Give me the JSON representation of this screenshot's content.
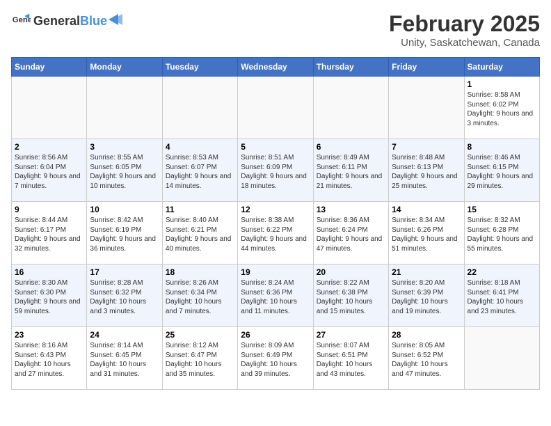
{
  "header": {
    "logo_general": "General",
    "logo_blue": "Blue",
    "title": "February 2025",
    "subtitle": "Unity, Saskatchewan, Canada"
  },
  "weekdays": [
    "Sunday",
    "Monday",
    "Tuesday",
    "Wednesday",
    "Thursday",
    "Friday",
    "Saturday"
  ],
  "weeks": [
    [
      {
        "day": "",
        "info": ""
      },
      {
        "day": "",
        "info": ""
      },
      {
        "day": "",
        "info": ""
      },
      {
        "day": "",
        "info": ""
      },
      {
        "day": "",
        "info": ""
      },
      {
        "day": "",
        "info": ""
      },
      {
        "day": "1",
        "info": "Sunrise: 8:58 AM\nSunset: 6:02 PM\nDaylight: 9 hours and 3 minutes."
      }
    ],
    [
      {
        "day": "2",
        "info": "Sunrise: 8:56 AM\nSunset: 6:04 PM\nDaylight: 9 hours and 7 minutes."
      },
      {
        "day": "3",
        "info": "Sunrise: 8:55 AM\nSunset: 6:05 PM\nDaylight: 9 hours and 10 minutes."
      },
      {
        "day": "4",
        "info": "Sunrise: 8:53 AM\nSunset: 6:07 PM\nDaylight: 9 hours and 14 minutes."
      },
      {
        "day": "5",
        "info": "Sunrise: 8:51 AM\nSunset: 6:09 PM\nDaylight: 9 hours and 18 minutes."
      },
      {
        "day": "6",
        "info": "Sunrise: 8:49 AM\nSunset: 6:11 PM\nDaylight: 9 hours and 21 minutes."
      },
      {
        "day": "7",
        "info": "Sunrise: 8:48 AM\nSunset: 6:13 PM\nDaylight: 9 hours and 25 minutes."
      },
      {
        "day": "8",
        "info": "Sunrise: 8:46 AM\nSunset: 6:15 PM\nDaylight: 9 hours and 29 minutes."
      }
    ],
    [
      {
        "day": "9",
        "info": "Sunrise: 8:44 AM\nSunset: 6:17 PM\nDaylight: 9 hours and 32 minutes."
      },
      {
        "day": "10",
        "info": "Sunrise: 8:42 AM\nSunset: 6:19 PM\nDaylight: 9 hours and 36 minutes."
      },
      {
        "day": "11",
        "info": "Sunrise: 8:40 AM\nSunset: 6:21 PM\nDaylight: 9 hours and 40 minutes."
      },
      {
        "day": "12",
        "info": "Sunrise: 8:38 AM\nSunset: 6:22 PM\nDaylight: 9 hours and 44 minutes."
      },
      {
        "day": "13",
        "info": "Sunrise: 8:36 AM\nSunset: 6:24 PM\nDaylight: 9 hours and 47 minutes."
      },
      {
        "day": "14",
        "info": "Sunrise: 8:34 AM\nSunset: 6:26 PM\nDaylight: 9 hours and 51 minutes."
      },
      {
        "day": "15",
        "info": "Sunrise: 8:32 AM\nSunset: 6:28 PM\nDaylight: 9 hours and 55 minutes."
      }
    ],
    [
      {
        "day": "16",
        "info": "Sunrise: 8:30 AM\nSunset: 6:30 PM\nDaylight: 9 hours and 59 minutes."
      },
      {
        "day": "17",
        "info": "Sunrise: 8:28 AM\nSunset: 6:32 PM\nDaylight: 10 hours and 3 minutes."
      },
      {
        "day": "18",
        "info": "Sunrise: 8:26 AM\nSunset: 6:34 PM\nDaylight: 10 hours and 7 minutes."
      },
      {
        "day": "19",
        "info": "Sunrise: 8:24 AM\nSunset: 6:36 PM\nDaylight: 10 hours and 11 minutes."
      },
      {
        "day": "20",
        "info": "Sunrise: 8:22 AM\nSunset: 6:38 PM\nDaylight: 10 hours and 15 minutes."
      },
      {
        "day": "21",
        "info": "Sunrise: 8:20 AM\nSunset: 6:39 PM\nDaylight: 10 hours and 19 minutes."
      },
      {
        "day": "22",
        "info": "Sunrise: 8:18 AM\nSunset: 6:41 PM\nDaylight: 10 hours and 23 minutes."
      }
    ],
    [
      {
        "day": "23",
        "info": "Sunrise: 8:16 AM\nSunset: 6:43 PM\nDaylight: 10 hours and 27 minutes."
      },
      {
        "day": "24",
        "info": "Sunrise: 8:14 AM\nSunset: 6:45 PM\nDaylight: 10 hours and 31 minutes."
      },
      {
        "day": "25",
        "info": "Sunrise: 8:12 AM\nSunset: 6:47 PM\nDaylight: 10 hours and 35 minutes."
      },
      {
        "day": "26",
        "info": "Sunrise: 8:09 AM\nSunset: 6:49 PM\nDaylight: 10 hours and 39 minutes."
      },
      {
        "day": "27",
        "info": "Sunrise: 8:07 AM\nSunset: 6:51 PM\nDaylight: 10 hours and 43 minutes."
      },
      {
        "day": "28",
        "info": "Sunrise: 8:05 AM\nSunset: 6:52 PM\nDaylight: 10 hours and 47 minutes."
      },
      {
        "day": "",
        "info": ""
      }
    ]
  ]
}
